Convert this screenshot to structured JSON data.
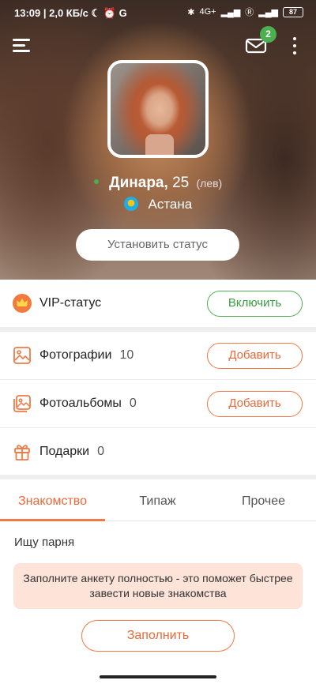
{
  "status_bar": {
    "left": "13:09 | 2,0 КБ/с",
    "network": "4G+",
    "battery": "87"
  },
  "header": {
    "mail_badge": "2",
    "profile": {
      "name": "Динара,",
      "age": "25",
      "zodiac": "(лев)",
      "city": "Астана"
    },
    "set_status_label": "Установить статус"
  },
  "vip": {
    "label": "VIP-статус",
    "button": "Включить"
  },
  "media": {
    "photos": {
      "label": "Фотографии",
      "count": "10",
      "button": "Добавить"
    },
    "albums": {
      "label": "Фотоальбомы",
      "count": "0",
      "button": "Добавить"
    },
    "gifts": {
      "label": "Подарки",
      "count": "0"
    }
  },
  "tabs": [
    {
      "label": "Знакомство"
    },
    {
      "label": "Типаж"
    },
    {
      "label": "Прочее"
    }
  ],
  "dating": {
    "looking_for": "Ищу парня",
    "hint": "Заполните анкету полностью - это поможет быстрее завести новые знакомства",
    "fill_button": "Заполнить"
  },
  "colors": {
    "accent_orange": "#ef7a45",
    "accent_green": "#4caf50",
    "hint_bg": "#fde3d8"
  }
}
